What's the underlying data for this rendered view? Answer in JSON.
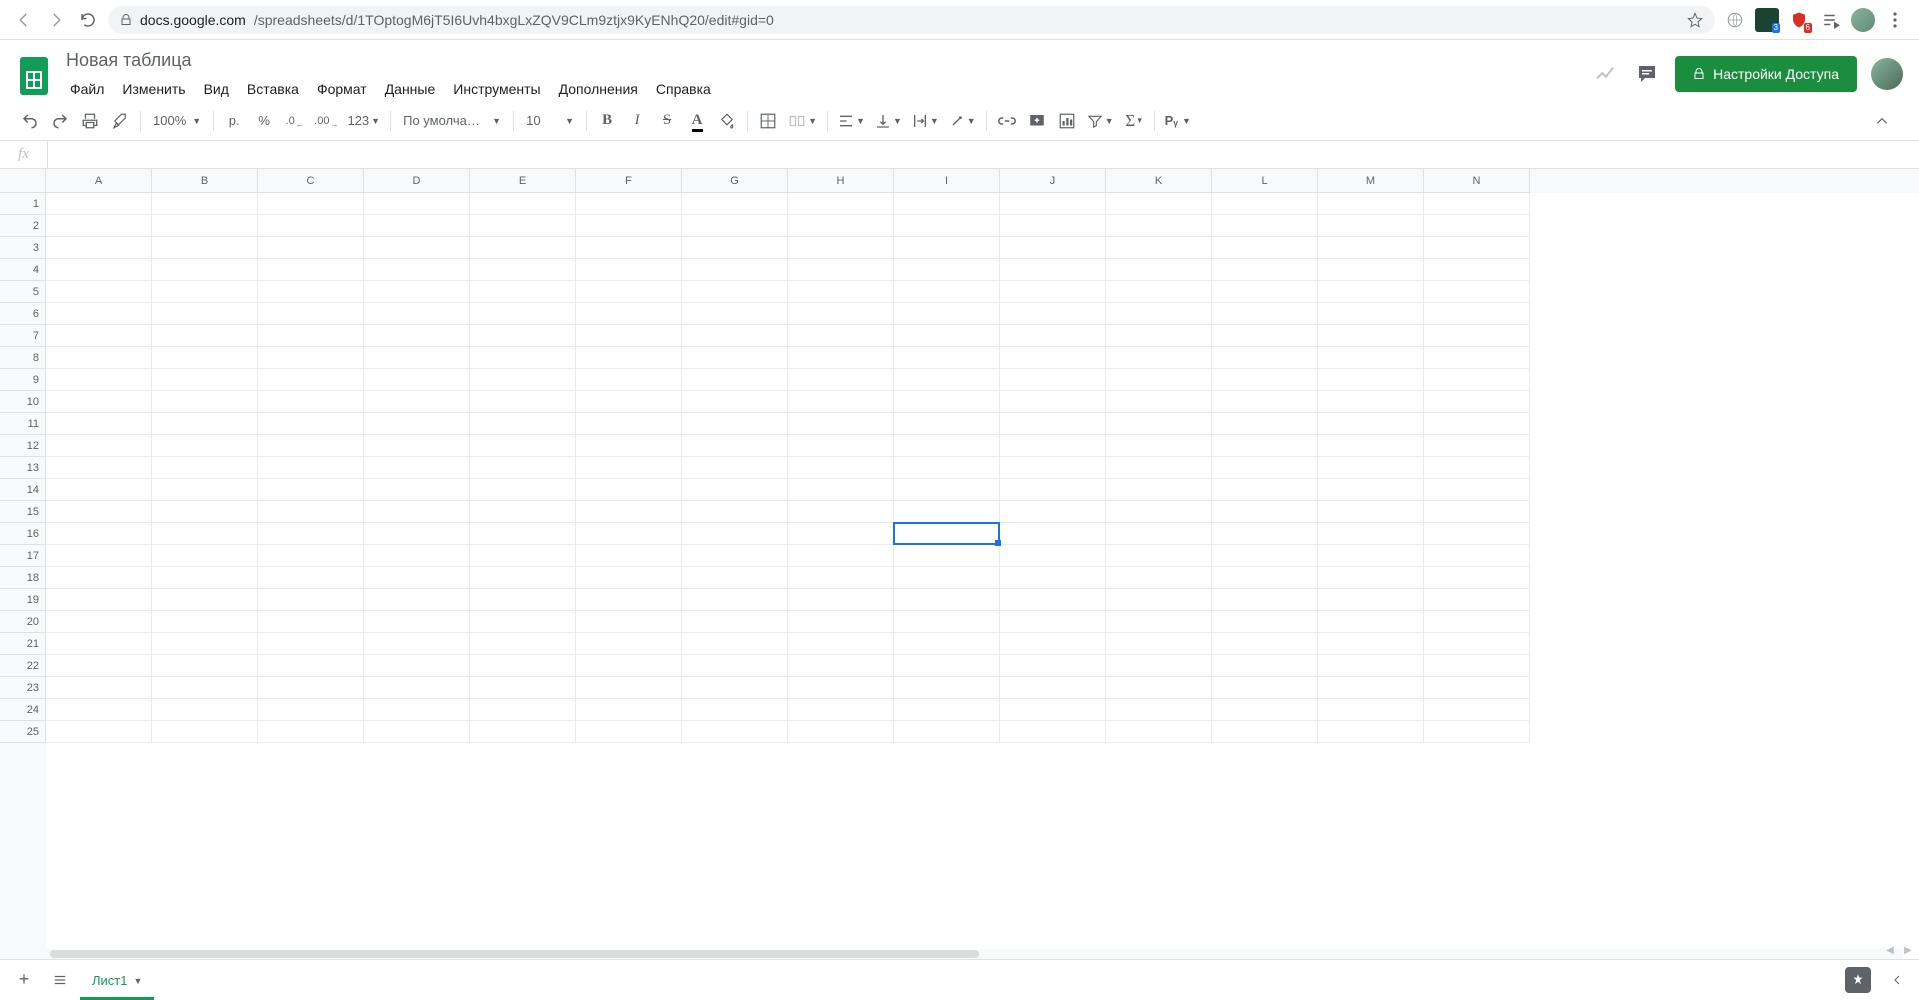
{
  "browser": {
    "url_host": "docs.google.com",
    "url_path": "/spreadsheets/d/1TOptogM6jT5I6Uvh4bxgLxZQV9CLm9ztjx9KyENhQ20/edit#gid=0",
    "ext_badge_blue": "3",
    "ext_badge_red": "6"
  },
  "doc": {
    "title": "Новая таблица",
    "menus": [
      "Файл",
      "Изменить",
      "Вид",
      "Вставка",
      "Формат",
      "Данные",
      "Инструменты",
      "Дополнения",
      "Справка"
    ],
    "share_label": "Настройки Доступа"
  },
  "toolbar": {
    "zoom": "100%",
    "currency": "р.",
    "percent": "%",
    "dec_less": ".0",
    "dec_more": ".00",
    "num_format": "123",
    "font": "По умолча…",
    "font_size": "10",
    "cyrillic_r": "Рᵧ"
  },
  "formula_bar": {
    "fx": "fx",
    "value": ""
  },
  "grid": {
    "cols": [
      "A",
      "B",
      "C",
      "D",
      "E",
      "F",
      "G",
      "H",
      "I",
      "J",
      "K",
      "L",
      "M",
      "N"
    ],
    "rows": 25,
    "selected_col_index": 8,
    "selected_row_index": 15
  },
  "sheet_bar": {
    "tab_label": "Лист1"
  }
}
